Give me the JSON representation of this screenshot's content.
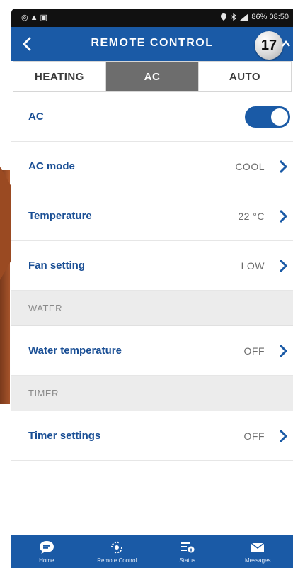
{
  "status_bar": {
    "left_icons": "◎▲▣",
    "right_text": "86%  08:50"
  },
  "header": {
    "title": "REMOTE CONTROL",
    "badge": "17"
  },
  "tabs": [
    {
      "label": "HEATING",
      "active": false
    },
    {
      "label": "AC",
      "active": true
    },
    {
      "label": "AUTO",
      "active": false
    }
  ],
  "rows": {
    "ac": {
      "label": "AC",
      "toggle_on": true
    },
    "ac_mode": {
      "label": "AC mode",
      "value": "COOL"
    },
    "temperature": {
      "label": "Temperature",
      "value": "22 °C"
    },
    "fan": {
      "label": "Fan setting",
      "value": "LOW"
    },
    "water_section": "WATER",
    "water_temp": {
      "label": "Water temperature",
      "value": "OFF"
    },
    "timer_section": "TIMER",
    "timer": {
      "label": "Timer settings",
      "value": "OFF"
    }
  },
  "bottom_nav": [
    {
      "label": "Home",
      "icon": "chat-bubble-icon"
    },
    {
      "label": "Remote Control",
      "icon": "remote-icon"
    },
    {
      "label": "Status",
      "icon": "status-icon"
    },
    {
      "label": "Messages",
      "icon": "mail-icon"
    }
  ],
  "colors": {
    "primary": "#1a5aa6",
    "active_tab": "#6d6d6d",
    "label": "#1a4f95"
  }
}
